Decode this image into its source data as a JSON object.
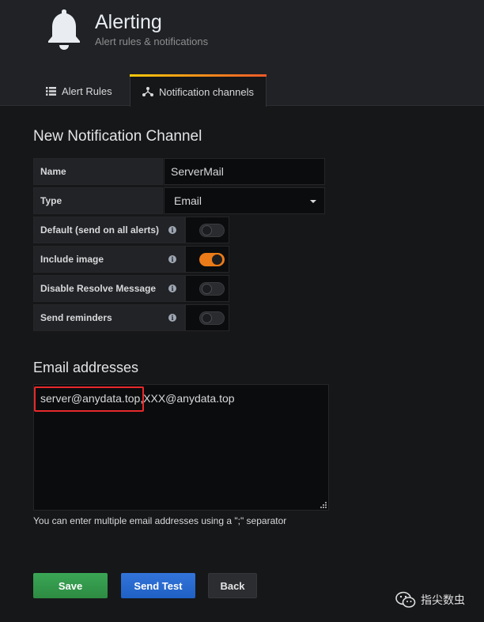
{
  "header": {
    "title": "Alerting",
    "subtitle": "Alert rules & notifications",
    "icon": "bell-icon"
  },
  "tabs": [
    {
      "label": "Alert Rules",
      "icon": "list-icon",
      "active": false
    },
    {
      "label": "Notification channels",
      "icon": "share-nodes-icon",
      "active": true
    }
  ],
  "form": {
    "title": "New Notification Channel",
    "name_label": "Name",
    "name_value": "ServerMail",
    "type_label": "Type",
    "type_value": "Email",
    "toggles": [
      {
        "label": "Default (send on all alerts)",
        "on": false
      },
      {
        "label": "Include image",
        "on": true
      },
      {
        "label": "Disable Resolve Message",
        "on": false
      },
      {
        "label": "Send reminders",
        "on": false
      }
    ]
  },
  "email": {
    "title": "Email addresses",
    "value_highlighted": "server@anydata.top,",
    "value_rest": "XXX@anydata.top",
    "help": "You can enter multiple email addresses using a \";\" separator"
  },
  "buttons": {
    "save": "Save",
    "send_test": "Send Test",
    "back": "Back"
  },
  "watermark": {
    "text": "指尖数虫"
  },
  "colors": {
    "accent": "#eb7b18",
    "save": "#2d8b42",
    "send_test": "#1f60c4",
    "highlight": "#e8292a"
  }
}
